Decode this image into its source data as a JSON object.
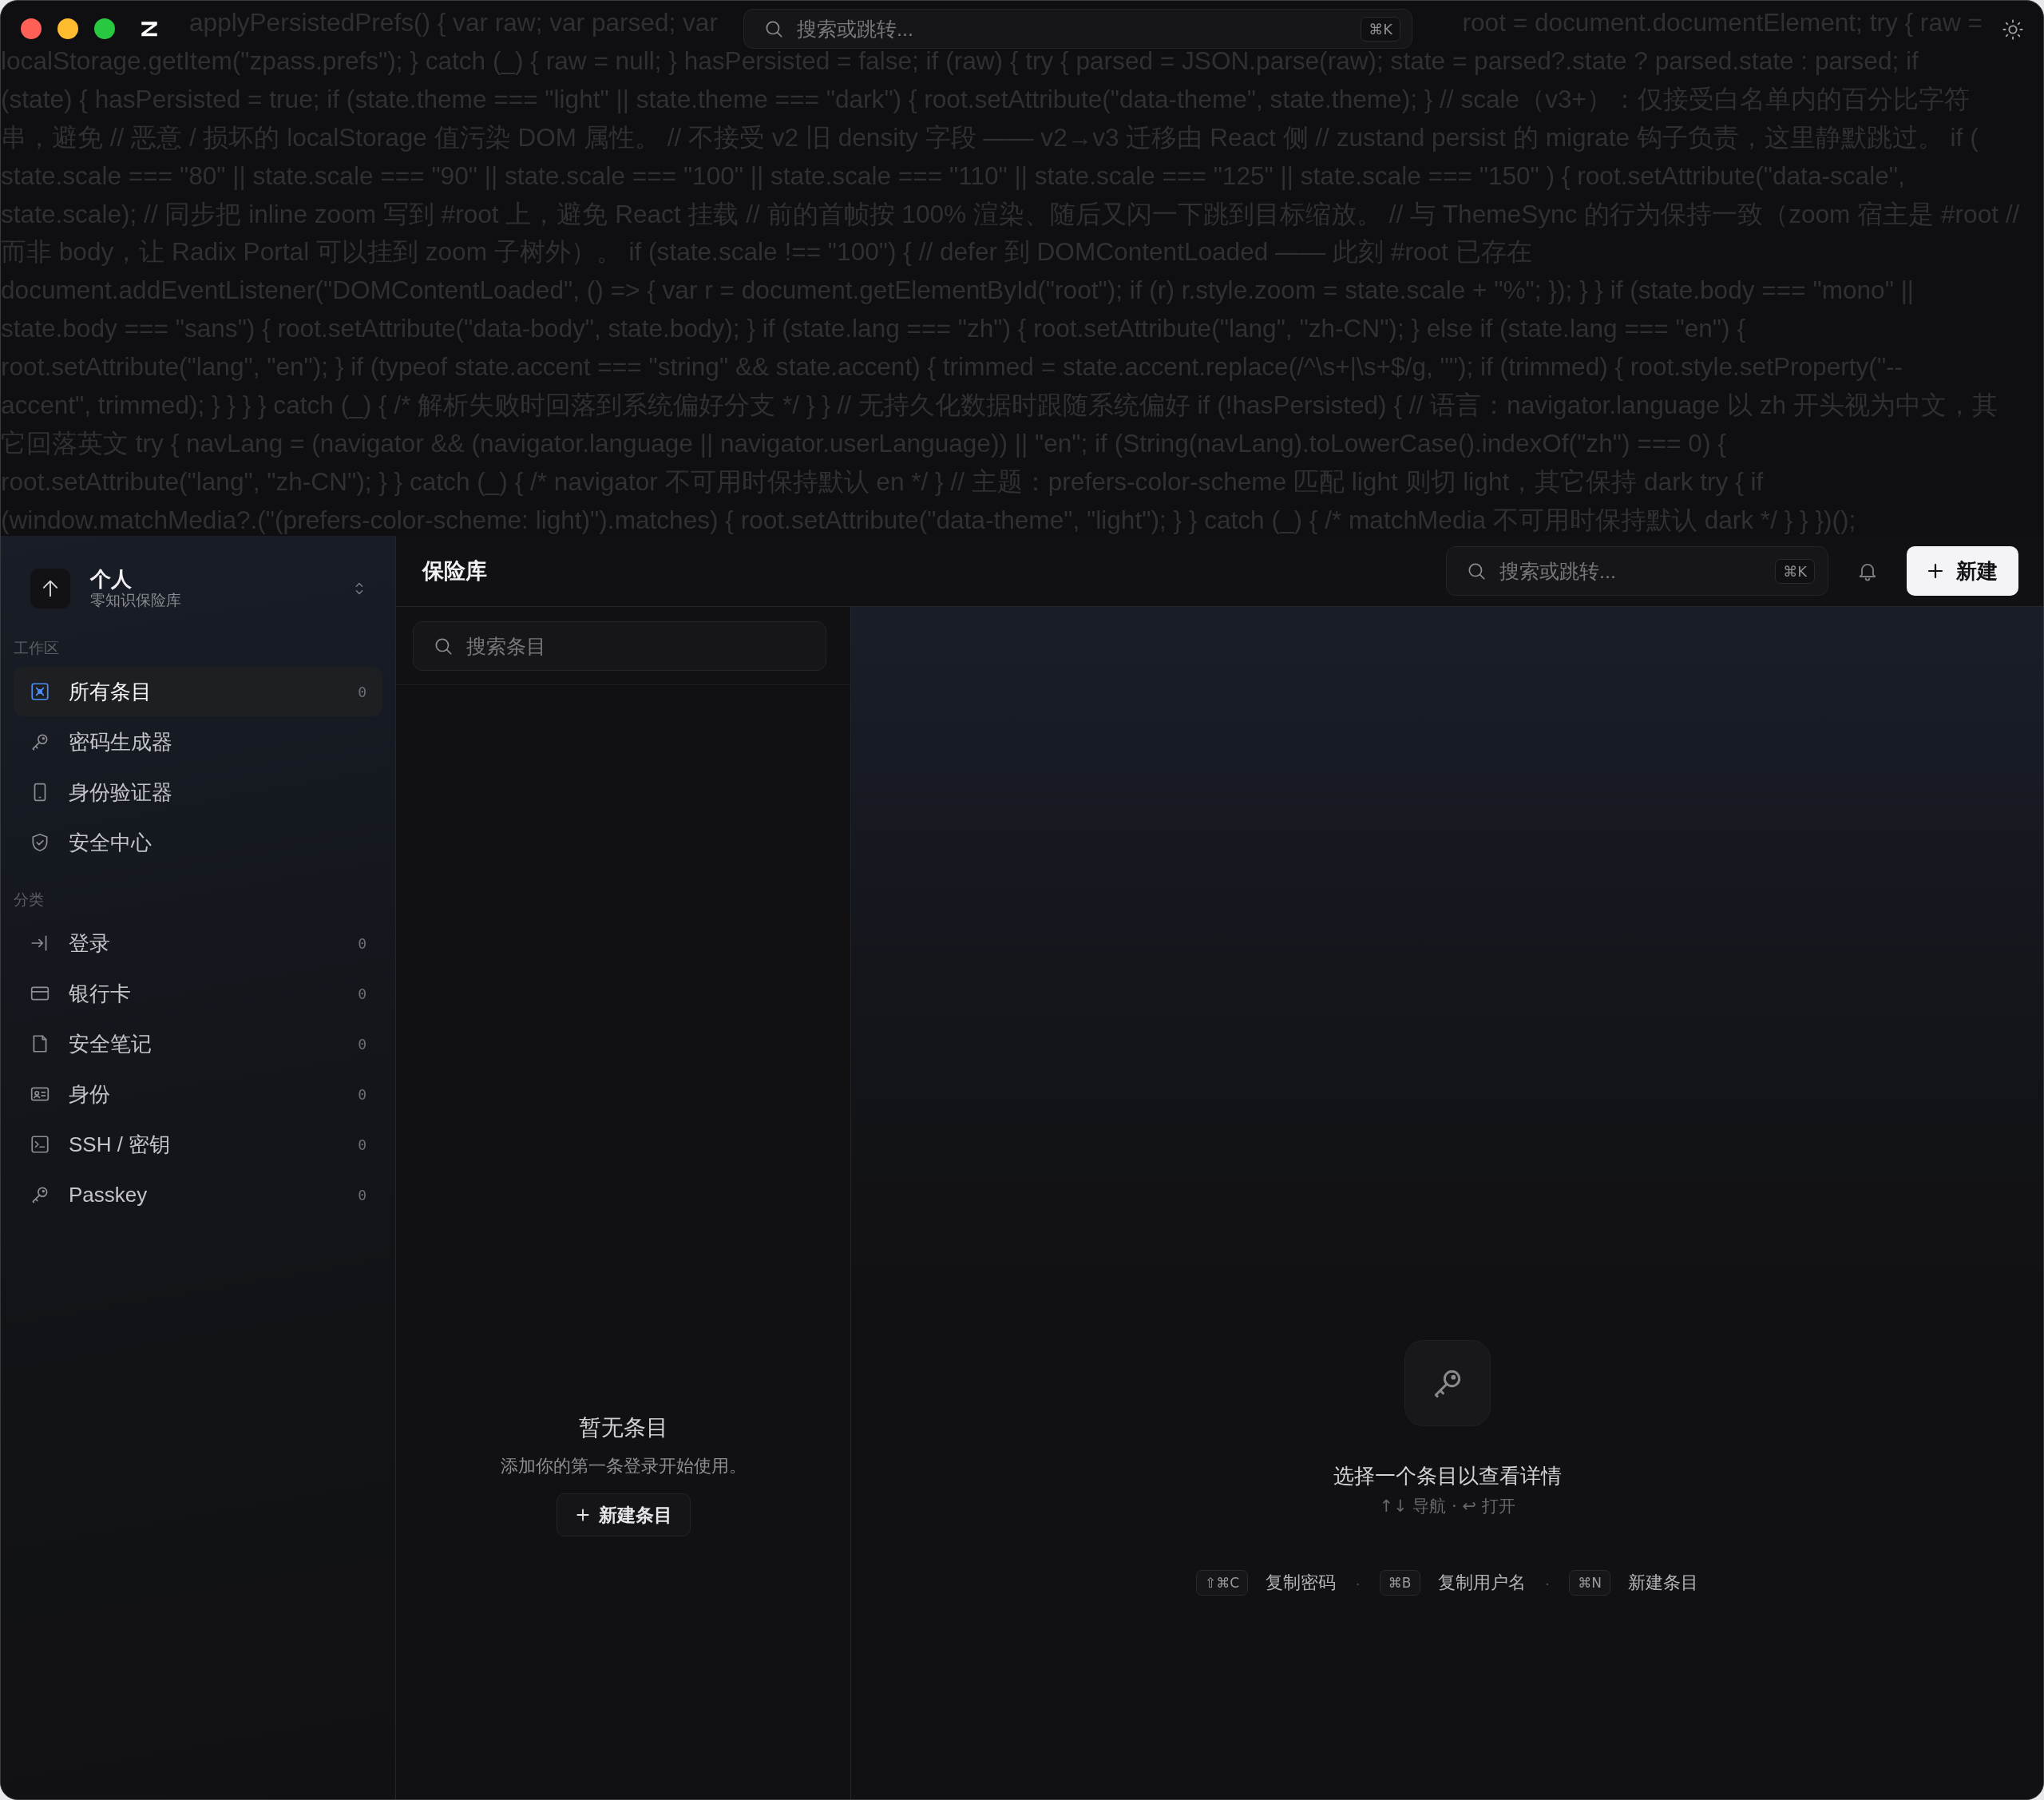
{
  "background_code": {
    "first_line": [
      "applyPersistedPrefs() { var raw; var parsed; var",
      "root = document.documentElement; try { raw ="
    ],
    "lines": [
      "localStorage.getItem(\"zpass.prefs\"); } catch (_) { raw = null; } hasPersisted = false; if (raw) { try { parsed = JSON.parse(raw); state = parsed?.state ? parsed.state : parsed; if",
      "(state) { hasPersisted = true; if (state.theme === \"light\" || state.theme === \"dark\") { root.setAttribute(\"data-theme\", state.theme); } // scale（v3+）：仅接受白名单内的百分比字符",
      "串，避免 // 恶意 / 损坏的 localStorage 值污染 DOM 属性。 // 不接受 v2 旧 density 字段 —— v2→v3 迁移由 React 侧 // zustand persist 的 migrate 钩子负责，这里静默跳过。 if (",
      "state.scale === \"80\" || state.scale === \"90\" || state.scale === \"100\" || state.scale === \"110\" || state.scale === \"125\" || state.scale === \"150\" ) { root.setAttribute(\"data-scale\",",
      "state.scale); // 同步把 inline zoom 写到 #root 上，避免 React 挂载 // 前的首帧按 100% 渲染、随后又闪一下跳到目标缩放。 // 与 ThemeSync 的行为保持一致（zoom 宿主是 #root //",
      "而非 body，让 Radix Portal 可以挂到 zoom 子树外）。 if (state.scale !== \"100\") { // defer 到 DOMContentLoaded —— 此刻 #root 已存在",
      "document.addEventListener(\"DOMContentLoaded\", () => { var r = document.getElementById(\"root\"); if (r) r.style.zoom = state.scale + \"%\"; }); } } if (state.body === \"mono\" ||",
      "state.body === \"sans\") { root.setAttribute(\"data-body\", state.body); } if (state.lang === \"zh\") { root.setAttribute(\"lang\", \"zh-CN\"); } else if (state.lang === \"en\") {",
      "root.setAttribute(\"lang\", \"en\"); } if (typeof state.accent === \"string\" && state.accent) { trimmed = state.accent.replace(/^\\s+|\\s+$/g, \"\"); if (trimmed) { root.style.setProperty(\"--",
      "accent\", trimmed); } } } } catch (_) { /* 解析失败时回落到系统偏好分支 */ } } // 无持久化数据时跟随系统偏好 if (!hasPersisted) { // 语言：navigator.language 以 zh 开头视为中文，其",
      "它回落英文 try { navLang = (navigator && (navigator.language || navigator.userLanguage)) || \"en\"; if (String(navLang).toLowerCase().indexOf(\"zh\") === 0) {",
      "root.setAttribute(\"lang\", \"zh-CN\"); } } catch (_) { /* navigator 不可用时保持默认 en */ } // 主题：prefers-color-scheme 匹配 light 则切 light，其它保持 dark try { if",
      "(window.matchMedia?.(\"(prefers-color-scheme: light)\").matches) { root.setAttribute(\"data-theme\", \"light\"); } } catch (_) { /* matchMedia 不可用时保持默认 dark */ } } })();"
    ]
  },
  "title_bar": {
    "search": {
      "placeholder": "搜索或跳转...",
      "shortcut": "⌘K"
    }
  },
  "sidebar": {
    "vault": {
      "name": "个人",
      "subtitle": "零知识保险库"
    },
    "sections": [
      {
        "label": "工作区",
        "items": [
          {
            "label": "所有条目",
            "count": "0",
            "selected": true
          },
          {
            "label": "密码生成器",
            "selected": false
          },
          {
            "label": "身份验证器",
            "selected": false
          },
          {
            "label": "安全中心",
            "selected": false
          }
        ]
      },
      {
        "label": "分类",
        "items": [
          {
            "label": "登录",
            "count": "0",
            "selected": false
          },
          {
            "label": "银行卡",
            "count": "0",
            "selected": false
          },
          {
            "label": "安全笔记",
            "count": "0",
            "selected": false
          },
          {
            "label": "身份",
            "count": "0",
            "selected": false
          },
          {
            "label": "SSH / 密钥",
            "count": "0",
            "selected": false
          },
          {
            "label": "Passkey",
            "count": "0",
            "selected": false
          }
        ]
      }
    ]
  },
  "header": {
    "title": "保险库",
    "search": {
      "placeholder": "搜索或跳转...",
      "shortcut": "⌘K"
    },
    "new_button": "新建"
  },
  "list_pane": {
    "search": {
      "placeholder": "搜索条目"
    },
    "empty": {
      "title": "暂无条目",
      "message": "添加你的第一条登录开始使用。",
      "button": "新建条目"
    }
  },
  "detail_pane": {
    "title": "选择一个条目以查看详情",
    "hint": "↑↓ 导航 · ↩ 打开",
    "shortcuts": [
      {
        "kind": "shortcut",
        "keys": "⇧⌘C",
        "label": "复制密码"
      },
      {
        "kind": "separator",
        "text": "·"
      },
      {
        "kind": "shortcut",
        "keys": "⌘B",
        "label": "复制用户名"
      },
      {
        "kind": "separator",
        "text": "·"
      },
      {
        "kind": "shortcut",
        "keys": "⌘N",
        "label": "新建条目"
      }
    ]
  }
}
